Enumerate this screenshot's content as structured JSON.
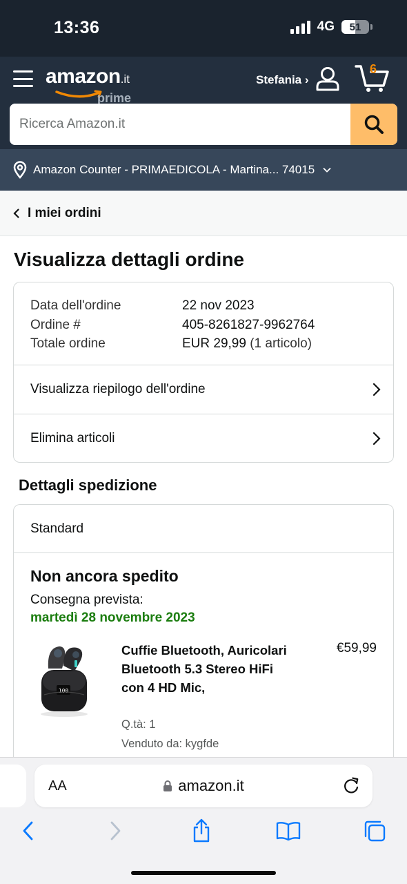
{
  "status_bar": {
    "time": "13:36",
    "network": "4G",
    "battery": "51",
    "battery_level": 0.51
  },
  "header": {
    "logo_text": "amazon",
    "logo_tld": ".it",
    "logo_prime": "prime",
    "user_label": "Stefania ›",
    "cart_count": "6",
    "search_placeholder": "Ricerca Amazon.it",
    "location": "Amazon Counter - PRIMAEDICOLA - Martina... 74015"
  },
  "breadcrumb": {
    "label": "I miei ordini"
  },
  "page": {
    "title": "Visualizza dettagli ordine"
  },
  "order": {
    "rows": [
      {
        "label": "Data dell'ordine",
        "value": "22 nov 2023"
      },
      {
        "label": "Ordine #",
        "value": "405-8261827-9962764"
      },
      {
        "label": "Totale ordine",
        "value": "EUR 29,99",
        "note": "(1 articolo)"
      }
    ],
    "links": [
      "Visualizza riepilogo dell'ordine",
      "Elimina articoli"
    ]
  },
  "shipping": {
    "section_title": "Dettagli spedizione",
    "method": "Standard",
    "status": "Non ancora spedito",
    "eta_label": "Consegna prevista:",
    "eta_date": "martedì 28 novembre 2023",
    "product": {
      "title": "Cuffie Bluetooth, Auricolari Bluetooth 5.3 Stereo HiFi con 4 HD Mic,",
      "price": "€59,99",
      "qty": "Q.tà: 1",
      "seller": "Venduto da: kygfde",
      "screen_text": "100"
    }
  },
  "safari": {
    "aa_label": "AA",
    "url": "amazon.it"
  },
  "colors": {
    "header_bg": "#232f3e",
    "location_bg": "#37475a",
    "search_button": "#febd69",
    "eta_green": "#1b7d0f",
    "cart_orange": "#f08804"
  }
}
